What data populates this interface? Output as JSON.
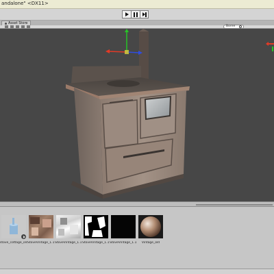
{
  "window": {
    "title": "andalone\" <DX11>"
  },
  "playbar": {
    "play": "play",
    "pause": "pause",
    "step": "step"
  },
  "tabs": [
    {
      "label": "Asset Store"
    }
  ],
  "scene_toolbar": {
    "label": "",
    "search_text": "Borne"
  },
  "assets": {
    "items": [
      {
        "label": "stove_cottage_old",
        "thumb": "stove-mesh"
      },
      {
        "label": "StoveVintage_1.11",
        "thumb": "diffuse-texture"
      },
      {
        "label": "StoveVintage_1.11",
        "thumb": "gloss-texture"
      },
      {
        "label": "StoveVintage_1.11",
        "thumb": "mask-texture"
      },
      {
        "label": "StoveVintage_1.11",
        "thumb": "black-texture"
      },
      {
        "label": "Vintage_old",
        "thumb": "material-sphere"
      }
    ]
  },
  "colors": {
    "viewport_bg": "#474747",
    "gizmo_y": "#27c427",
    "gizmo_x": "#e23a26",
    "gizmo_z": "#2f4de0",
    "titlebar": "#ecebd3"
  }
}
